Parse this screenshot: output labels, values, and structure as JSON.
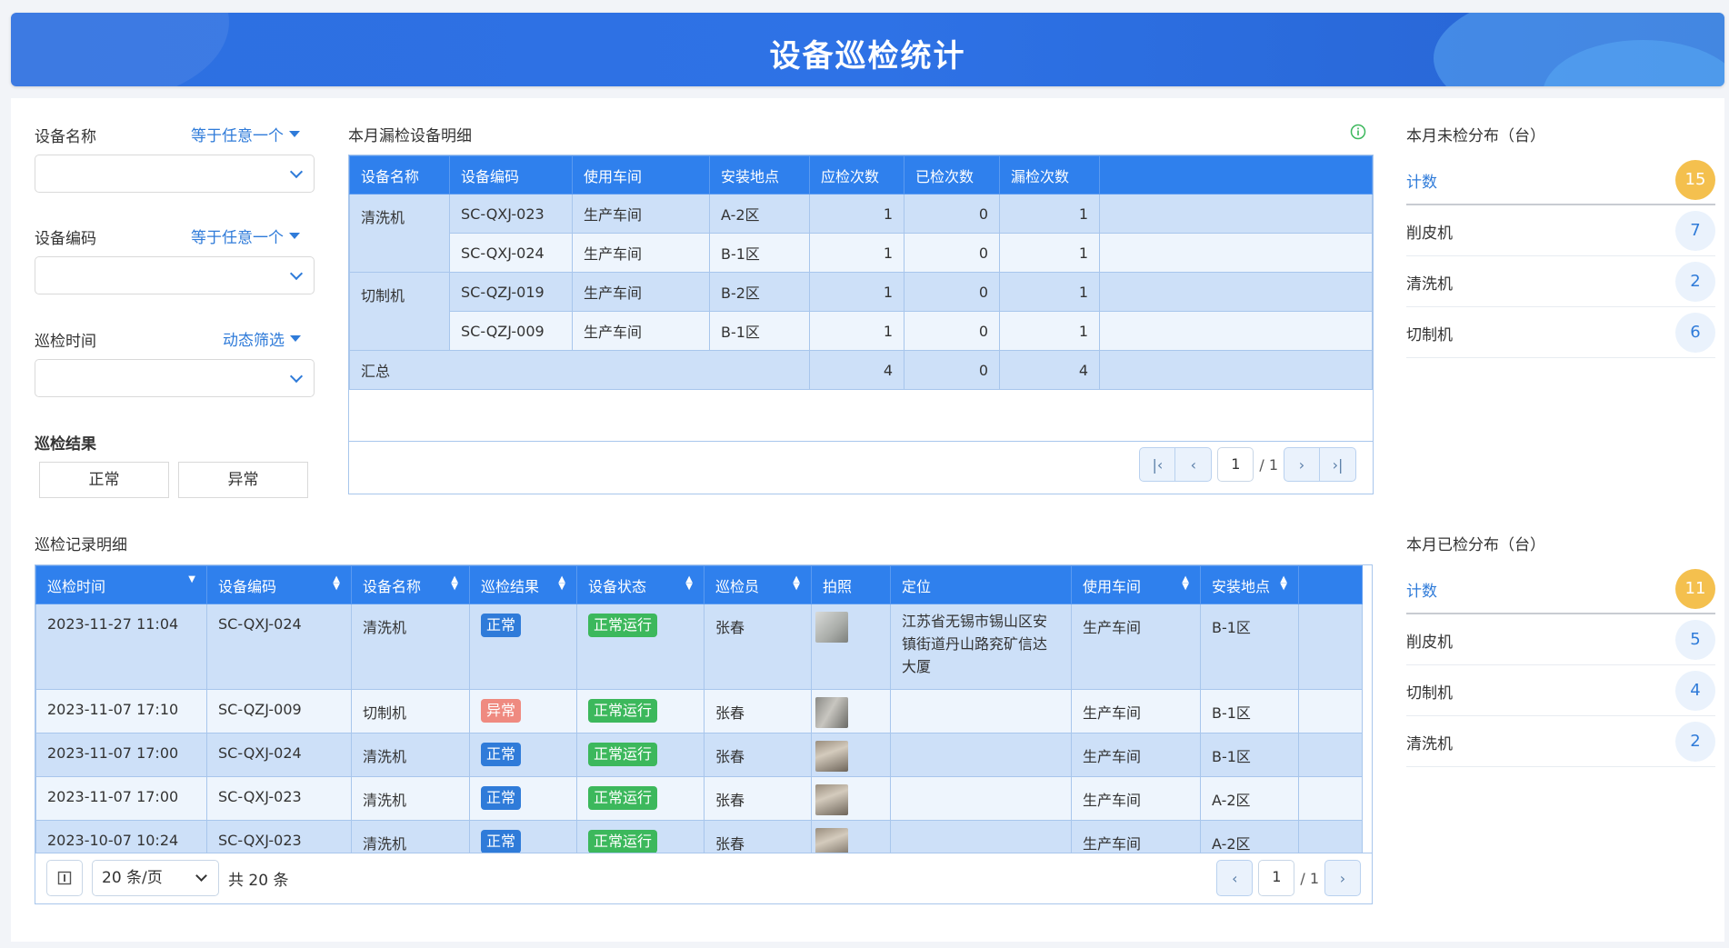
{
  "page_title": "设备巡检统计",
  "filters": {
    "device_name": {
      "label": "设备名称",
      "mode": "等于任意一个"
    },
    "device_code": {
      "label": "设备编码",
      "mode": "等于任意一个"
    },
    "inspect_time": {
      "label": "巡检时间",
      "mode": "动态筛选"
    },
    "result": {
      "label": "巡检结果",
      "options": [
        "正常",
        "异常"
      ]
    }
  },
  "missed_table": {
    "title": "本月漏检设备明细",
    "headers": [
      "设备名称",
      "设备编码",
      "使用车间",
      "安装地点",
      "应检次数",
      "已检次数",
      "漏检次数"
    ],
    "groups": [
      {
        "name": "清洗机",
        "rows": [
          {
            "code": "SC-QXJ-023",
            "workshop": "生产车间",
            "location": "A-2区",
            "due": "1",
            "done": "0",
            "missed": "1"
          },
          {
            "code": "SC-QXJ-024",
            "workshop": "生产车间",
            "location": "B-1区",
            "due": "1",
            "done": "0",
            "missed": "1"
          }
        ]
      },
      {
        "name": "切制机",
        "rows": [
          {
            "code": "SC-QZJ-019",
            "workshop": "生产车间",
            "location": "B-2区",
            "due": "1",
            "done": "0",
            "missed": "1"
          },
          {
            "code": "SC-QZJ-009",
            "workshop": "生产车间",
            "location": "B-1区",
            "due": "1",
            "done": "0",
            "missed": "1"
          }
        ]
      }
    ],
    "total": {
      "label": "汇总",
      "due": "4",
      "done": "0",
      "missed": "4"
    },
    "pager": {
      "page": "1",
      "of": "/ 1"
    }
  },
  "unchecked": {
    "title": "本月未检分布（台）",
    "head": {
      "name": "计数",
      "count": "15"
    },
    "items": [
      {
        "name": "削皮机",
        "count": "7"
      },
      {
        "name": "清洗机",
        "count": "2"
      },
      {
        "name": "切制机",
        "count": "6"
      }
    ]
  },
  "checked": {
    "title": "本月已检分布（台）",
    "head": {
      "name": "计数",
      "count": "11"
    },
    "items": [
      {
        "name": "削皮机",
        "count": "5"
      },
      {
        "name": "切制机",
        "count": "4"
      },
      {
        "name": "清洗机",
        "count": "2"
      }
    ]
  },
  "records": {
    "title": "巡检记录明细",
    "headers": [
      "巡检时间",
      "设备编码",
      "设备名称",
      "巡检结果",
      "设备状态",
      "巡检员",
      "拍照",
      "定位",
      "使用车间",
      "安装地点"
    ],
    "rows": [
      {
        "time": "2023-11-27 11:04",
        "code": "SC-QXJ-024",
        "name": "清洗机",
        "result": "正常",
        "result_color": "blue",
        "status": "正常运行",
        "inspector": "张春",
        "location": "江苏省无锡市锡山区安镇街道丹山路兖矿信达大厦",
        "workshop": "生产车间",
        "site": "B-1区"
      },
      {
        "time": "2023-11-07 17:10",
        "code": "SC-QZJ-009",
        "name": "切制机",
        "result": "异常",
        "result_color": "red",
        "status": "正常运行",
        "inspector": "张春",
        "location": "",
        "workshop": "生产车间",
        "site": "B-1区"
      },
      {
        "time": "2023-11-07 17:00",
        "code": "SC-QXJ-024",
        "name": "清洗机",
        "result": "正常",
        "result_color": "blue",
        "status": "正常运行",
        "inspector": "张春",
        "location": "",
        "workshop": "生产车间",
        "site": "B-1区"
      },
      {
        "time": "2023-11-07 17:00",
        "code": "SC-QXJ-023",
        "name": "清洗机",
        "result": "正常",
        "result_color": "blue",
        "status": "正常运行",
        "inspector": "张春",
        "location": "",
        "workshop": "生产车间",
        "site": "A-2区"
      },
      {
        "time": "2023-10-07 10:24",
        "code": "SC-QXJ-023",
        "name": "清洗机",
        "result": "正常",
        "result_color": "blue",
        "status": "正常运行",
        "inspector": "张春",
        "location": "",
        "workshop": "生产车间",
        "site": "A-2区"
      }
    ],
    "footer": {
      "page_size": "20 条/页",
      "total": "共 20 条",
      "page": "1",
      "of": "/ 1"
    }
  }
}
